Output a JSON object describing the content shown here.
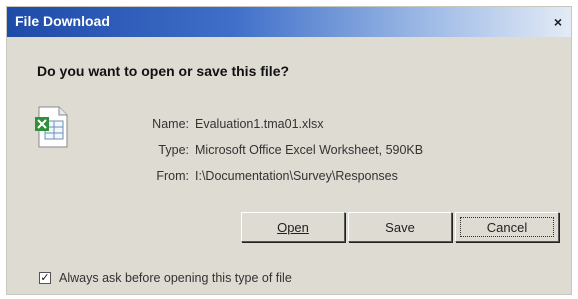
{
  "window": {
    "title": "File Download",
    "close_glyph": "×"
  },
  "question": "Do you want to open or save this file?",
  "file": {
    "icon": "excel-file-icon",
    "name_label": "Name:",
    "name_value": "Evaluation1.tma01.xlsx",
    "type_label": "Type:",
    "type_value": "Microsoft Office Excel Worksheet, 590KB",
    "from_label": "From:",
    "from_value": "I:\\Documentation\\Survey\\Responses"
  },
  "buttons": {
    "open": "Open",
    "save": "Save",
    "cancel": "Cancel"
  },
  "checkbox": {
    "checked": true,
    "mark": "✓",
    "label": "Always ask before opening this type of file"
  },
  "colors": {
    "title_start": "#1e4aa8",
    "title_end": "#e3ebf6",
    "dialog_bg": "#dedbd3"
  }
}
